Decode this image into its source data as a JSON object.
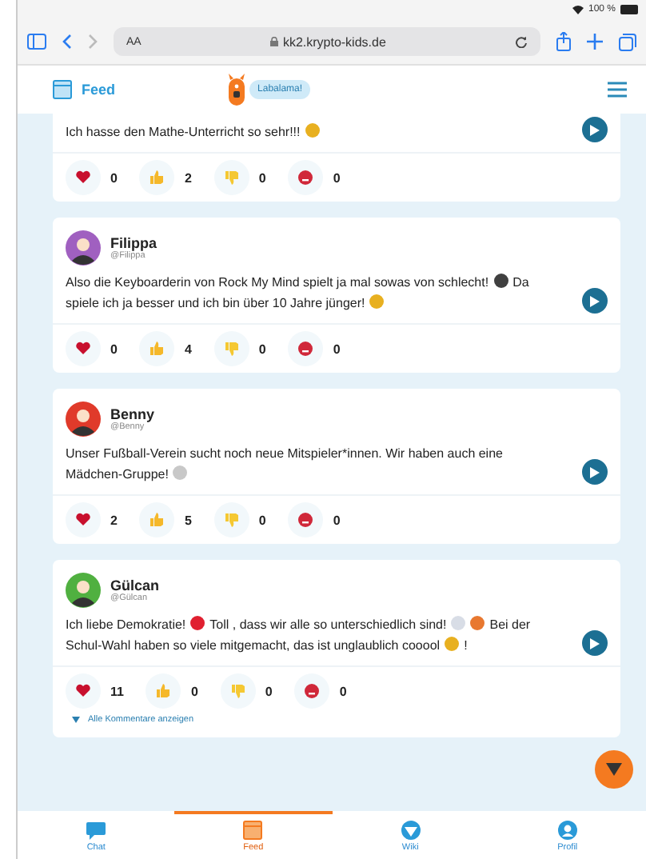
{
  "browser": {
    "battery": "100 %",
    "text_size": "AA",
    "url": "kk2.krypto-kids.de"
  },
  "header": {
    "title": "Feed",
    "speech": "Labalama!"
  },
  "posts": [
    {
      "parts": [
        {
          "kind": "text",
          "text": "Ich hasse den Mathe-Unterricht so sehr!!!"
        },
        {
          "kind": "emoji",
          "color": "#e8b020"
        }
      ],
      "reactions": [
        {
          "kind": "heart",
          "count": "0"
        },
        {
          "kind": "like",
          "count": "2"
        },
        {
          "kind": "dislike",
          "count": "0"
        },
        {
          "kind": "angry",
          "count": "0"
        }
      ]
    },
    {
      "author": "Filippa",
      "handle": "@Filippa",
      "color": "#a060c0",
      "parts": [
        {
          "kind": "text",
          "text": "Also die Keyboarderin von Rock My Mind spielt ja mal sowas von schlecht!"
        },
        {
          "kind": "emoji",
          "color": "#404040"
        },
        {
          "kind": "text",
          "text": "Da"
        },
        {
          "kind": "text",
          "text": "spiele ich ja besser und ich bin über 10 Jahre jünger!"
        },
        {
          "kind": "emoji",
          "color": "#e8b020"
        }
      ],
      "reactions": [
        {
          "kind": "heart",
          "count": "0"
        },
        {
          "kind": "like",
          "count": "4"
        },
        {
          "kind": "dislike",
          "count": "0"
        },
        {
          "kind": "angry",
          "count": "0"
        }
      ]
    },
    {
      "author": "Benny",
      "handle": "@Benny",
      "color": "#e03a2a",
      "parts": [
        {
          "kind": "text",
          "text": "Unser Fußball-Verein sucht noch neue Mitspieler*innen. Wir haben auch eine"
        },
        {
          "kind": "text",
          "text": "Mädchen-Gruppe!"
        },
        {
          "kind": "emoji",
          "color": "#c8c8c8"
        }
      ],
      "reactions": [
        {
          "kind": "heart",
          "count": "2"
        },
        {
          "kind": "like",
          "count": "5"
        },
        {
          "kind": "dislike",
          "count": "0"
        },
        {
          "kind": "angry",
          "count": "0"
        }
      ]
    },
    {
      "author": "Gülcan",
      "handle": "@Gülcan",
      "color": "#50b040",
      "parts": [
        {
          "kind": "text",
          "text": "Ich liebe Demokratie!"
        },
        {
          "kind": "emoji",
          "color": "#e02030"
        },
        {
          "kind": "text",
          "text": "Toll , dass wir alle so unterschiedlich sind!"
        },
        {
          "kind": "emoji",
          "color": "#d8dde6"
        },
        {
          "kind": "emoji",
          "color": "#e87830"
        },
        {
          "kind": "text",
          "text": "Bei der"
        },
        {
          "kind": "text",
          "text": "Schul-Wahl haben so viele mitgemacht, das ist unglaublich cooool"
        },
        {
          "kind": "emoji",
          "color": "#e8b020"
        },
        {
          "kind": "text",
          "text": "!"
        }
      ],
      "reactions": [
        {
          "kind": "heart",
          "count": "11"
        },
        {
          "kind": "like",
          "count": "0"
        },
        {
          "kind": "dislike",
          "count": "0"
        },
        {
          "kind": "angry",
          "count": "0"
        }
      ],
      "comments_link": "Alle Kommentare anzeigen"
    }
  ],
  "nav": [
    {
      "kind": "chat",
      "label": "Chat",
      "selected": false
    },
    {
      "kind": "feed",
      "label": "Feed",
      "selected": true
    },
    {
      "kind": "wiki",
      "label": "Wiki",
      "selected": false
    },
    {
      "kind": "profile",
      "label": "Profil",
      "selected": false
    }
  ]
}
